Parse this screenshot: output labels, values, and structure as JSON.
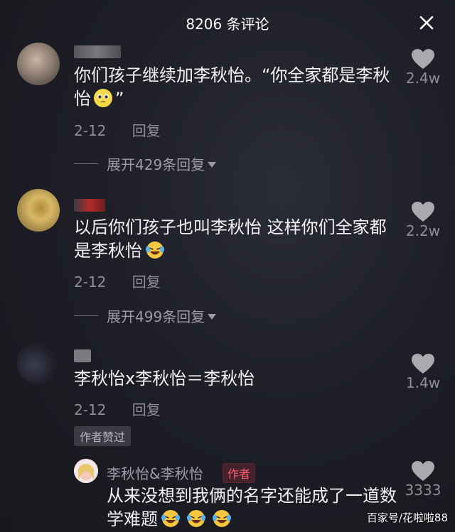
{
  "header": {
    "title": "8206 条评论",
    "close_icon": "close-icon"
  },
  "comments": [
    {
      "text_before_emoji": "你们孩子继续加李秋怡。“你全家都是李秋怡",
      "text_after_emoji": "”",
      "emoji": "pleading-face-emoji",
      "date": "2-12",
      "reply_label": "回复",
      "expand_label": "展开429条回复",
      "like_count": "2.4w"
    },
    {
      "text_before_emoji": "以后你们孩子也叫李秋怡 这样你们全家都是李秋怡",
      "text_after_emoji": "",
      "emoji": "laughing-tears-emoji",
      "date": "2-12",
      "reply_label": "回复",
      "expand_label": "展开499条回复",
      "like_count": "2.2w"
    },
    {
      "text_before_emoji": "李秋怡x李秋怡＝李秋怡",
      "text_after_emoji": "",
      "date": "2-12",
      "reply_label": "回复",
      "badge": "作者赞过",
      "like_count": "1.4w"
    }
  ],
  "author_reply": {
    "name": "李秋怡&李秋怡",
    "badge": "作者",
    "text": "从来没想到我俩的名字还能成了一道数学难题",
    "like_count": "3333"
  },
  "watermark": "百家号/花啦啦88",
  "colors": {
    "background": "#1b1c22",
    "text": "#f2f2f2",
    "muted": "#8d8e96",
    "author_badge": "#ff5d71"
  }
}
